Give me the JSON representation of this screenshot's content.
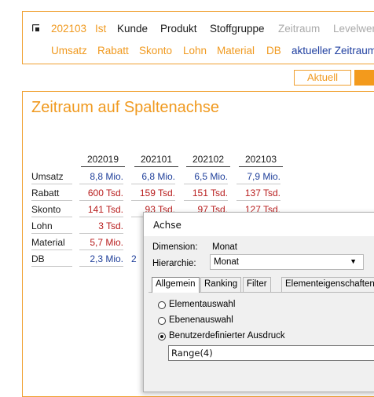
{
  "nav": {
    "row1": [
      "202103",
      "Ist",
      "Kunde",
      "Produkt",
      "Stoffgruppe",
      "Zeitraum",
      "Levelwer"
    ],
    "row2": [
      "Umsatz",
      "Rabatt",
      "Skonto",
      "Lohn",
      "Material",
      "DB",
      "aktueller Zeitraum"
    ]
  },
  "buttons": {
    "aktuell": "Aktuell"
  },
  "main": {
    "title": "Zeitraum auf Spaltenachse",
    "columns": [
      "202019",
      "202101",
      "202102",
      "202103"
    ],
    "rows": [
      {
        "label": "Umsatz",
        "cells": [
          "8,8 Mio.",
          "6,8 Mio.",
          "6,5 Mio.",
          "7,9 Mio."
        ]
      },
      {
        "label": "Rabatt",
        "cells": [
          "600 Tsd.",
          "159 Tsd.",
          "151 Tsd.",
          "137 Tsd."
        ]
      },
      {
        "label": "Skonto",
        "cells": [
          "141 Tsd.",
          "93 Tsd.",
          "97 Tsd.",
          "127 Tsd."
        ]
      },
      {
        "label": "Lohn",
        "cells": [
          "3 Tsd.",
          "",
          "",
          ""
        ]
      },
      {
        "label": "Material",
        "cells": [
          "5,7 Mio.",
          "",
          "",
          ""
        ]
      },
      {
        "label": "DB",
        "cells": [
          "2,3 Mio.",
          "2",
          "",
          ""
        ]
      }
    ]
  },
  "dialog": {
    "title": "Achse",
    "dimension_label": "Dimension:",
    "dimension_value": "Monat",
    "hierarchy_label": "Hierarchie:",
    "hierarchy_value": "Monat",
    "tabs": [
      "Allgemein",
      "Ranking",
      "Filter",
      "Elementeigenschaften"
    ],
    "options": [
      "Elementauswahl",
      "Ebenenauswahl",
      "Benutzerdefinierter Ausdruck"
    ],
    "selected_option": "Benutzerdefinierter Ausdruck",
    "expression_value": "Range(4)"
  },
  "colors": {
    "accent": "#f09a20",
    "positive": "#1f3f9a",
    "negative": "#b81d1d"
  }
}
